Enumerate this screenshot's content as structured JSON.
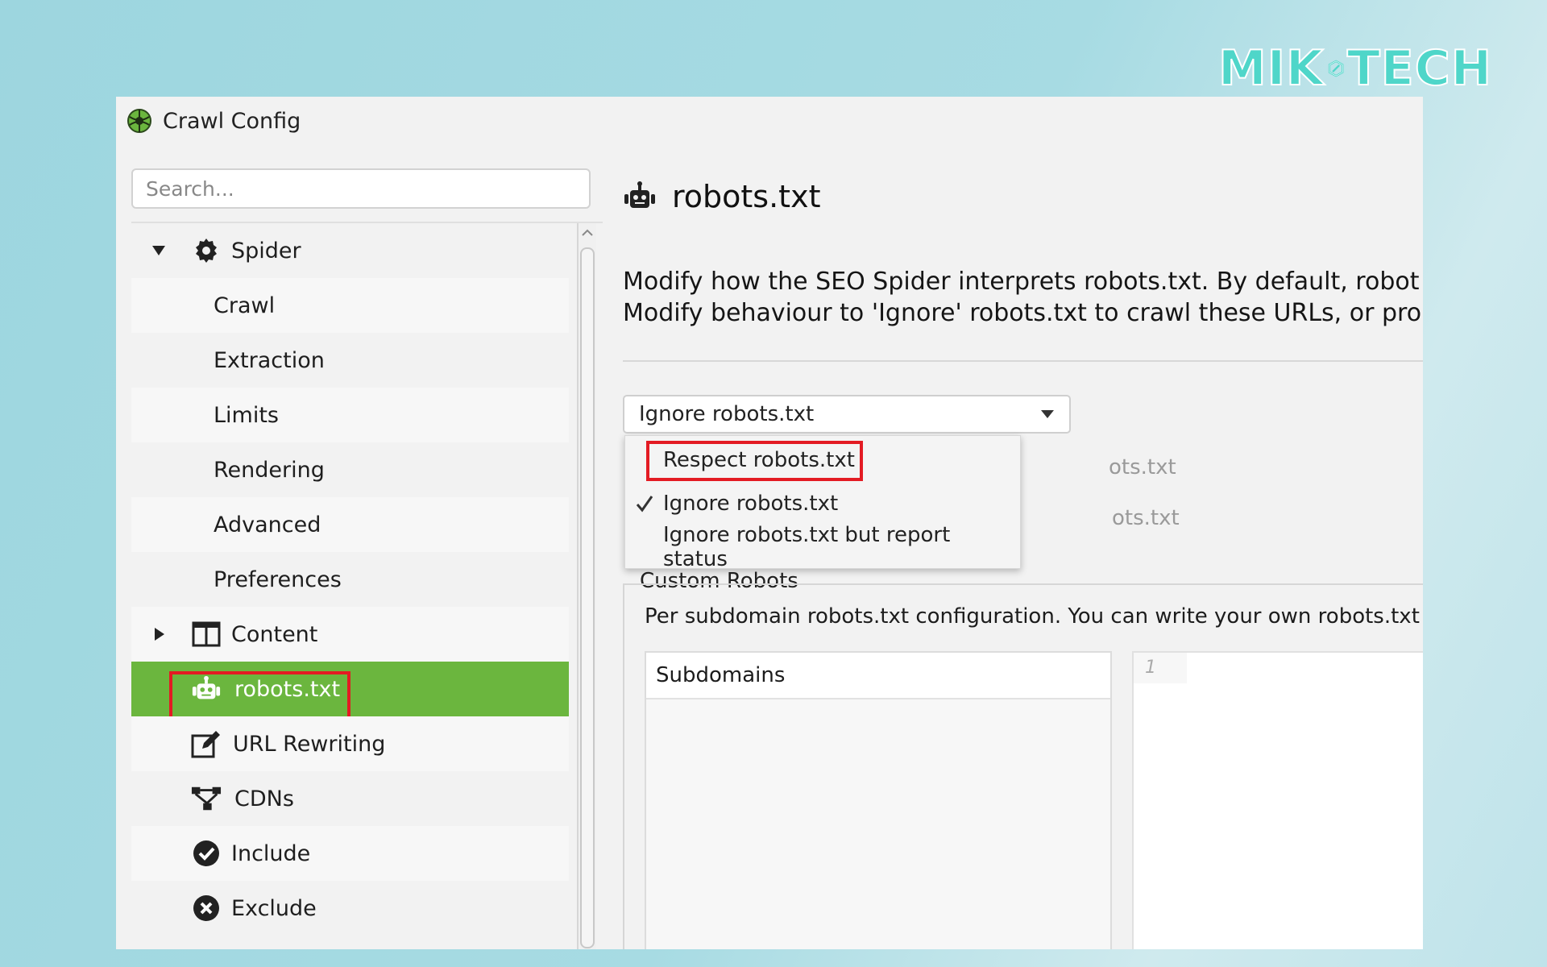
{
  "brand": {
    "text_left": "MIK",
    "text_right": "TECH",
    "color": "#4fd6c9"
  },
  "window": {
    "title": "Crawl Config",
    "app_icon": "spider-globe-icon"
  },
  "sidebar": {
    "search": {
      "placeholder": "Search..."
    },
    "items": [
      {
        "label": "Spider",
        "icon": "gear-icon",
        "expanded": true
      },
      {
        "label": "Crawl"
      },
      {
        "label": "Extraction"
      },
      {
        "label": "Limits"
      },
      {
        "label": "Rendering"
      },
      {
        "label": "Advanced"
      },
      {
        "label": "Preferences"
      },
      {
        "label": "Content",
        "icon": "columns-icon",
        "expanded": false
      },
      {
        "label": "robots.txt",
        "icon": "robot-icon",
        "selected": true
      },
      {
        "label": "URL Rewriting",
        "icon": "edit-icon"
      },
      {
        "label": "CDNs",
        "icon": "network-icon"
      },
      {
        "label": "Include",
        "icon": "check-circle-icon"
      },
      {
        "label": "Exclude",
        "icon": "x-circle-icon"
      }
    ],
    "selected_color": "#6bb63e"
  },
  "main": {
    "title": "robots.txt",
    "title_icon": "robot-icon",
    "description_line1": "Modify how the SEO Spider interprets robots.txt. By default, robots.tx",
    "description_line2": "Modify behaviour to 'Ignore' robots.txt to crawl these URLs, or provide",
    "mode_select": {
      "value": "Ignore robots.txt",
      "options": [
        {
          "label": "Respect robots.txt",
          "highlighted": true
        },
        {
          "label": "Ignore robots.txt",
          "checked": true
        },
        {
          "label": "Ignore robots.txt but report status"
        }
      ]
    },
    "obscured_text_1": "ots.txt",
    "obscured_text_2": "ots.txt",
    "custom_robots": {
      "legend": "Custom Robots",
      "description": "Per subdomain robots.txt configuration. You can write your own robots.txt file",
      "subdomains_header": "Subdomains",
      "editor_line_number": "1"
    }
  },
  "highlight_color": "#e31b23"
}
